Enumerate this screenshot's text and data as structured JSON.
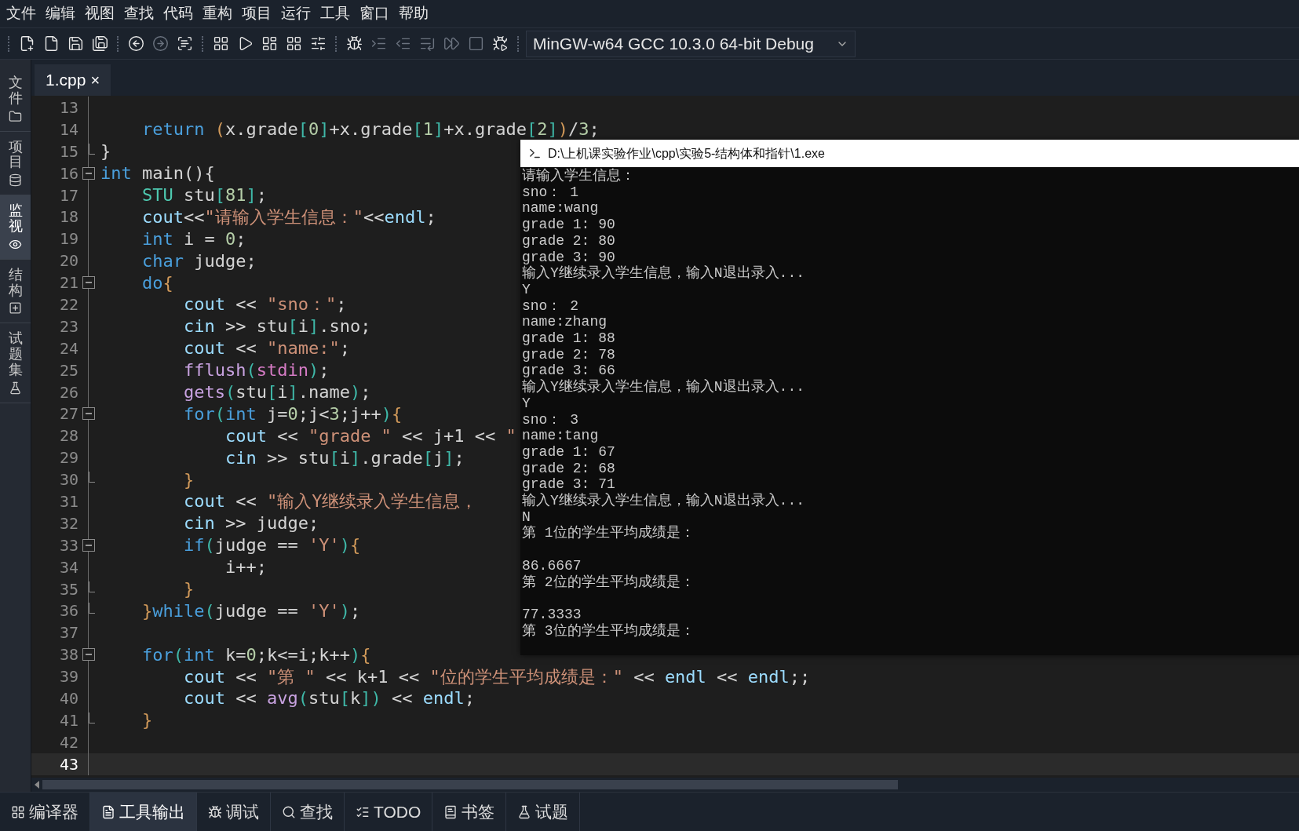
{
  "menu": [
    "文件",
    "编辑",
    "视图",
    "查找",
    "代码",
    "重构",
    "项目",
    "运行",
    "工具",
    "窗口",
    "帮助"
  ],
  "toolbar": {
    "groups": [
      [
        {
          "kind": "new-file",
          "disabled": false
        },
        {
          "kind": "file",
          "disabled": false
        },
        {
          "kind": "save",
          "disabled": false
        },
        {
          "kind": "save-all",
          "disabled": false
        }
      ],
      [
        {
          "kind": "back",
          "disabled": false
        },
        {
          "kind": "forward",
          "disabled": true
        },
        {
          "kind": "scan",
          "disabled": false
        }
      ],
      [
        {
          "kind": "compile",
          "disabled": false
        },
        {
          "kind": "run",
          "disabled": false
        },
        {
          "kind": "compile-run",
          "disabled": false
        },
        {
          "kind": "rebuild",
          "disabled": false
        },
        {
          "kind": "options",
          "disabled": false
        }
      ],
      [
        {
          "kind": "debug",
          "disabled": false
        },
        {
          "kind": "step-over",
          "disabled": true
        },
        {
          "kind": "step-into",
          "disabled": true
        },
        {
          "kind": "step-out",
          "disabled": true
        },
        {
          "kind": "continue",
          "disabled": true
        },
        {
          "kind": "stop",
          "disabled": true
        },
        {
          "kind": "add-watch",
          "disabled": false
        }
      ]
    ],
    "compiler": "MinGW-w64 GCC 10.3.0 64-bit Debug"
  },
  "sidebar": {
    "items": [
      {
        "label": "文件",
        "kind": "files",
        "selected": false
      },
      {
        "label": "项目",
        "kind": "project",
        "selected": false
      },
      {
        "label": "监视",
        "kind": "watch",
        "selected": true
      },
      {
        "label": "结构",
        "kind": "structure",
        "selected": false
      },
      {
        "label": "试题集",
        "kind": "problems",
        "selected": false
      }
    ]
  },
  "editor": {
    "tabs": [
      {
        "label": "1.cpp",
        "close": "×",
        "selected": true
      }
    ],
    "lines": [
      {
        "number": "13",
        "current": false
      },
      {
        "number": "14",
        "current": false,
        "tokens": [
          {
            "kind": "kw",
            "text": "    return "
          },
          {
            "kind": "p",
            "text": "("
          },
          {
            "kind": "pl",
            "text": "x.grade"
          },
          {
            "kind": "br",
            "text": "["
          },
          {
            "kind": "num",
            "text": "0"
          },
          {
            "kind": "br",
            "text": "]"
          },
          {
            "kind": "pl",
            "text": "+x.grade"
          },
          {
            "kind": "br",
            "text": "["
          },
          {
            "kind": "num",
            "text": "1"
          },
          {
            "kind": "br",
            "text": "]"
          },
          {
            "kind": "pl",
            "text": "+x.grade"
          },
          {
            "kind": "br",
            "text": "["
          },
          {
            "kind": "num",
            "text": "2"
          },
          {
            "kind": "br",
            "text": "]"
          },
          {
            "kind": "p",
            "text": ")"
          },
          {
            "kind": "pl",
            "text": "/"
          },
          {
            "kind": "num",
            "text": "3"
          },
          {
            "kind": "pl",
            "text": ";"
          }
        ]
      },
      {
        "number": "15",
        "current": false,
        "fold_end": true,
        "tokens": [
          {
            "kind": "pl",
            "text": "}"
          }
        ]
      },
      {
        "number": "16",
        "current": false,
        "fold_start": true,
        "tokens": [
          {
            "kind": "kw",
            "text": "int"
          },
          {
            "kind": "pl",
            "text": " main(){"
          }
        ]
      },
      {
        "number": "17",
        "current": false,
        "tokens": [
          {
            "kind": "type",
            "text": "    STU"
          },
          {
            "kind": "pl",
            "text": " stu"
          },
          {
            "kind": "br",
            "text": "["
          },
          {
            "kind": "num",
            "text": "81"
          },
          {
            "kind": "br",
            "text": "]"
          },
          {
            "kind": "pl",
            "text": ";"
          }
        ]
      },
      {
        "number": "18",
        "current": false,
        "tokens": [
          {
            "kind": "var",
            "text": "    cout"
          },
          {
            "kind": "pl",
            "text": "<<"
          },
          {
            "kind": "str",
            "text": "\"请输入学生信息：\""
          },
          {
            "kind": "pl",
            "text": "<<"
          },
          {
            "kind": "var",
            "text": "endl"
          },
          {
            "kind": "pl",
            "text": ";"
          }
        ]
      },
      {
        "number": "19",
        "current": false,
        "tokens": [
          {
            "kind": "kw",
            "text": "    int"
          },
          {
            "kind": "pl",
            "text": " i = "
          },
          {
            "kind": "num",
            "text": "0"
          },
          {
            "kind": "pl",
            "text": ";"
          }
        ]
      },
      {
        "number": "20",
        "current": false,
        "tokens": [
          {
            "kind": "kw",
            "text": "    char"
          },
          {
            "kind": "pl",
            "text": " judge;"
          }
        ]
      },
      {
        "number": "21",
        "current": false,
        "fold_start": true,
        "tokens": [
          {
            "kind": "kw",
            "text": "    do"
          },
          {
            "kind": "p",
            "text": "{"
          }
        ]
      },
      {
        "number": "22",
        "current": false,
        "tokens": [
          {
            "kind": "var",
            "text": "        cout"
          },
          {
            "kind": "pl",
            "text": " << "
          },
          {
            "kind": "str",
            "text": "\"sno：\""
          },
          {
            "kind": "pl",
            "text": ";"
          }
        ]
      },
      {
        "number": "23",
        "current": false,
        "tokens": [
          {
            "kind": "var",
            "text": "        cin"
          },
          {
            "kind": "pl",
            "text": " >> stu"
          },
          {
            "kind": "br",
            "text": "["
          },
          {
            "kind": "pl",
            "text": "i"
          },
          {
            "kind": "br",
            "text": "]"
          },
          {
            "kind": "pl",
            "text": ".sno;"
          }
        ]
      },
      {
        "number": "24",
        "current": false,
        "tokens": [
          {
            "kind": "var",
            "text": "        cout"
          },
          {
            "kind": "pl",
            "text": " << "
          },
          {
            "kind": "str",
            "text": "\"name:\""
          },
          {
            "kind": "pl",
            "text": ";"
          }
        ]
      },
      {
        "number": "25",
        "current": false,
        "tokens": [
          {
            "kind": "fn",
            "text": "        fflush"
          },
          {
            "kind": "br",
            "text": "("
          },
          {
            "kind": "macro",
            "text": "stdin"
          },
          {
            "kind": "br",
            "text": ")"
          },
          {
            "kind": "pl",
            "text": ";"
          }
        ]
      },
      {
        "number": "26",
        "current": false,
        "tokens": [
          {
            "kind": "fn",
            "text": "        gets"
          },
          {
            "kind": "br",
            "text": "("
          },
          {
            "kind": "pl",
            "text": "stu"
          },
          {
            "kind": "br",
            "text": "["
          },
          {
            "kind": "pl",
            "text": "i"
          },
          {
            "kind": "br",
            "text": "]"
          },
          {
            "kind": "pl",
            "text": ".name"
          },
          {
            "kind": "br",
            "text": ")"
          },
          {
            "kind": "pl",
            "text": ";"
          }
        ]
      },
      {
        "number": "27",
        "current": false,
        "fold_start": true,
        "tokens": [
          {
            "kind": "kw",
            "text": "        for"
          },
          {
            "kind": "br",
            "text": "("
          },
          {
            "kind": "kw",
            "text": "int"
          },
          {
            "kind": "pl",
            "text": " j="
          },
          {
            "kind": "num",
            "text": "0"
          },
          {
            "kind": "pl",
            "text": ";j<"
          },
          {
            "kind": "num",
            "text": "3"
          },
          {
            "kind": "pl",
            "text": ";j++"
          },
          {
            "kind": "br",
            "text": ")"
          },
          {
            "kind": "p",
            "text": "{"
          }
        ]
      },
      {
        "number": "28",
        "current": false,
        "tokens": [
          {
            "kind": "var",
            "text": "            cout"
          },
          {
            "kind": "pl",
            "text": " << "
          },
          {
            "kind": "str",
            "text": "\"grade \""
          },
          {
            "kind": "pl",
            "text": " << j+1 << "
          },
          {
            "kind": "str",
            "text": "\""
          }
        ]
      },
      {
        "number": "29",
        "current": false,
        "tokens": [
          {
            "kind": "var",
            "text": "            cin"
          },
          {
            "kind": "pl",
            "text": " >> stu"
          },
          {
            "kind": "br",
            "text": "["
          },
          {
            "kind": "pl",
            "text": "i"
          },
          {
            "kind": "br",
            "text": "]"
          },
          {
            "kind": "pl",
            "text": ".grade"
          },
          {
            "kind": "br",
            "text": "["
          },
          {
            "kind": "pl",
            "text": "j"
          },
          {
            "kind": "br",
            "text": "]"
          },
          {
            "kind": "pl",
            "text": ";"
          }
        ]
      },
      {
        "number": "30",
        "current": false,
        "fold_end": true,
        "tokens": [
          {
            "kind": "p",
            "text": "        }"
          }
        ]
      },
      {
        "number": "31",
        "current": false,
        "tokens": [
          {
            "kind": "var",
            "text": "        cout"
          },
          {
            "kind": "pl",
            "text": " << "
          },
          {
            "kind": "str",
            "text": "\"输入Y继续录入学生信息，"
          }
        ]
      },
      {
        "number": "32",
        "current": false,
        "tokens": [
          {
            "kind": "var",
            "text": "        cin"
          },
          {
            "kind": "pl",
            "text": " >> judge;"
          }
        ]
      },
      {
        "number": "33",
        "current": false,
        "fold_start": true,
        "tokens": [
          {
            "kind": "kw",
            "text": "        if"
          },
          {
            "kind": "br",
            "text": "("
          },
          {
            "kind": "pl",
            "text": "judge == "
          },
          {
            "kind": "str",
            "text": "'Y'"
          },
          {
            "kind": "br",
            "text": ")"
          },
          {
            "kind": "p",
            "text": "{"
          }
        ]
      },
      {
        "number": "34",
        "current": false,
        "tokens": [
          {
            "kind": "pl",
            "text": "            i++;"
          }
        ]
      },
      {
        "number": "35",
        "current": false,
        "fold_end": true,
        "tokens": [
          {
            "kind": "p",
            "text": "        }"
          }
        ]
      },
      {
        "number": "36",
        "current": false,
        "fold_end": true,
        "tokens": [
          {
            "kind": "p",
            "text": "    }"
          },
          {
            "kind": "kw",
            "text": "while"
          },
          {
            "kind": "br",
            "text": "("
          },
          {
            "kind": "pl",
            "text": "judge == "
          },
          {
            "kind": "str",
            "text": "'Y'"
          },
          {
            "kind": "br",
            "text": ")"
          },
          {
            "kind": "pl",
            "text": ";"
          }
        ]
      },
      {
        "number": "37",
        "current": false
      },
      {
        "number": "38",
        "current": false,
        "fold_start": true,
        "tokens": [
          {
            "kind": "kw",
            "text": "    for"
          },
          {
            "kind": "br",
            "text": "("
          },
          {
            "kind": "kw",
            "text": "int"
          },
          {
            "kind": "pl",
            "text": " k="
          },
          {
            "kind": "num",
            "text": "0"
          },
          {
            "kind": "pl",
            "text": ";k<=i;k++"
          },
          {
            "kind": "br",
            "text": ")"
          },
          {
            "kind": "p",
            "text": "{"
          }
        ]
      },
      {
        "number": "39",
        "current": false,
        "tokens": [
          {
            "kind": "var",
            "text": "        cout"
          },
          {
            "kind": "pl",
            "text": " << "
          },
          {
            "kind": "str",
            "text": "\"第 \""
          },
          {
            "kind": "pl",
            "text": " << k+1 << "
          },
          {
            "kind": "str",
            "text": "\"位的学生平均成绩是：\""
          },
          {
            "kind": "pl",
            "text": " << "
          },
          {
            "kind": "var",
            "text": "endl"
          },
          {
            "kind": "pl",
            "text": " << "
          },
          {
            "kind": "var",
            "text": "endl"
          },
          {
            "kind": "pl",
            "text": ";;"
          }
        ]
      },
      {
        "number": "40",
        "current": false,
        "tokens": [
          {
            "kind": "var",
            "text": "        cout"
          },
          {
            "kind": "pl",
            "text": " << "
          },
          {
            "kind": "fn",
            "text": "avg"
          },
          {
            "kind": "br",
            "text": "("
          },
          {
            "kind": "pl",
            "text": "stu"
          },
          {
            "kind": "br",
            "text": "["
          },
          {
            "kind": "pl",
            "text": "k"
          },
          {
            "kind": "br",
            "text": "]"
          },
          {
            "kind": "br",
            "text": ")"
          },
          {
            "kind": "pl",
            "text": " << "
          },
          {
            "kind": "var",
            "text": "endl"
          },
          {
            "kind": "pl",
            "text": ";"
          }
        ]
      },
      {
        "number": "41",
        "current": false,
        "fold_end": true,
        "tokens": [
          {
            "kind": "p",
            "text": "    }"
          }
        ]
      },
      {
        "number": "42",
        "current": false
      },
      {
        "number": "43",
        "current": true
      }
    ]
  },
  "console": {
    "title": "D:\\上机课实验作业\\cpp\\实验5-结构体和指针\\1.exe",
    "output": "请输入学生信息：\nsno： 1\nname:wang\ngrade 1: 90\ngrade 2: 80\ngrade 3: 90\n输入Y继续录入学生信息，输入N退出录入...\nY\nsno： 2\nname:zhang\ngrade 1: 88\ngrade 2: 78\ngrade 3: 66\n输入Y继续录入学生信息，输入N退出录入...\nY\nsno： 3\nname:tang\ngrade 1: 67\ngrade 2: 68\ngrade 3: 71\n输入Y继续录入学生信息，输入N退出录入...\nN\n第 1位的学生平均成绩是：\n\n86.6667\n第 2位的学生平均成绩是：\n\n77.3333\n第 3位的学生平均成绩是："
  },
  "bottom_tabs": [
    {
      "label": "编译器",
      "kind": "compiler",
      "selected": false
    },
    {
      "label": "工具输出",
      "kind": "output",
      "selected": true
    },
    {
      "label": "调试",
      "kind": "debug",
      "selected": false
    },
    {
      "label": "查找",
      "kind": "search",
      "selected": false
    },
    {
      "label": "TODO",
      "kind": "todo",
      "selected": false
    },
    {
      "label": "书签",
      "kind": "bookmarks",
      "selected": false
    },
    {
      "label": "试题",
      "kind": "problem",
      "selected": false
    }
  ]
}
